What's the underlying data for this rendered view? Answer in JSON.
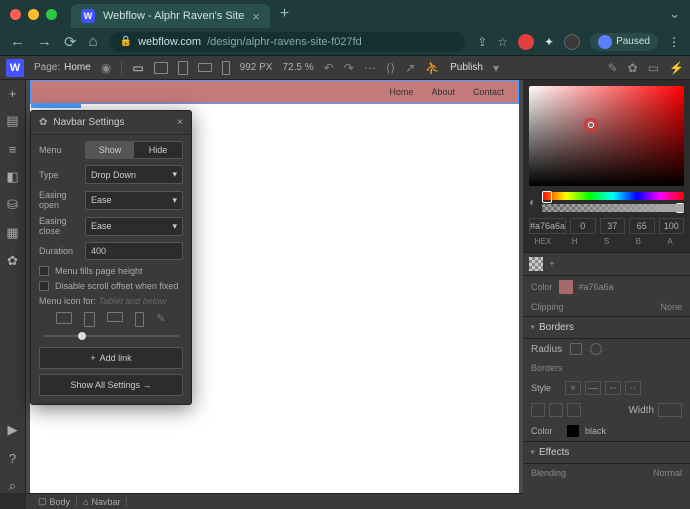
{
  "browser": {
    "tab_title": "Webflow - Alphr Raven's Site",
    "url_host": "webflow.com",
    "url_path": "/design/alphr-ravens-site-f027fd",
    "paused": "Paused"
  },
  "toolbar": {
    "page_label": "Page:",
    "page_name": "Home",
    "zoom_px": "992 PX",
    "zoom_pct": "72.5 %",
    "publish": "Publish"
  },
  "canvas": {
    "nav_items": [
      "Home",
      "About",
      "Contact"
    ]
  },
  "popover": {
    "title": "Navbar Settings",
    "menu_label": "Menu",
    "show": "Show",
    "hide": "Hide",
    "type_label": "Type",
    "type_value": "Drop Down",
    "easing_open_label": "Easing open",
    "easing_open_value": "Ease",
    "easing_close_label": "Easing close",
    "easing_close_value": "Ease",
    "duration_label": "Duration",
    "duration_value": "400",
    "fills_label": "Menu fills page height",
    "disable_scroll_label": "Disable scroll offset when fixed",
    "menu_icon_label": "Menu icon for:",
    "menu_icon_hint": "Tablet and below",
    "add_link": "Add link",
    "show_all": "Show All Settings"
  },
  "color": {
    "hex": "#a76a6a",
    "h": "0",
    "s": "37",
    "b": "65",
    "a": "100",
    "hex_label": "HEX",
    "h_label": "H",
    "s_label": "S",
    "b_label": "B",
    "a_label": "A",
    "color_label": "Color",
    "clipping_label": "Clipping",
    "clipping_value": "None"
  },
  "borders": {
    "section": "Borders",
    "radius_label": "Radius",
    "borders_label": "Borders",
    "style_label": "Style",
    "width_label": "Width",
    "color_label": "Color",
    "color_value": "black"
  },
  "effects": {
    "section": "Effects",
    "blending_label": "Blending",
    "blending_value": "Normal"
  },
  "breadcrumb": {
    "body": "Body",
    "navbar": "Navbar"
  }
}
